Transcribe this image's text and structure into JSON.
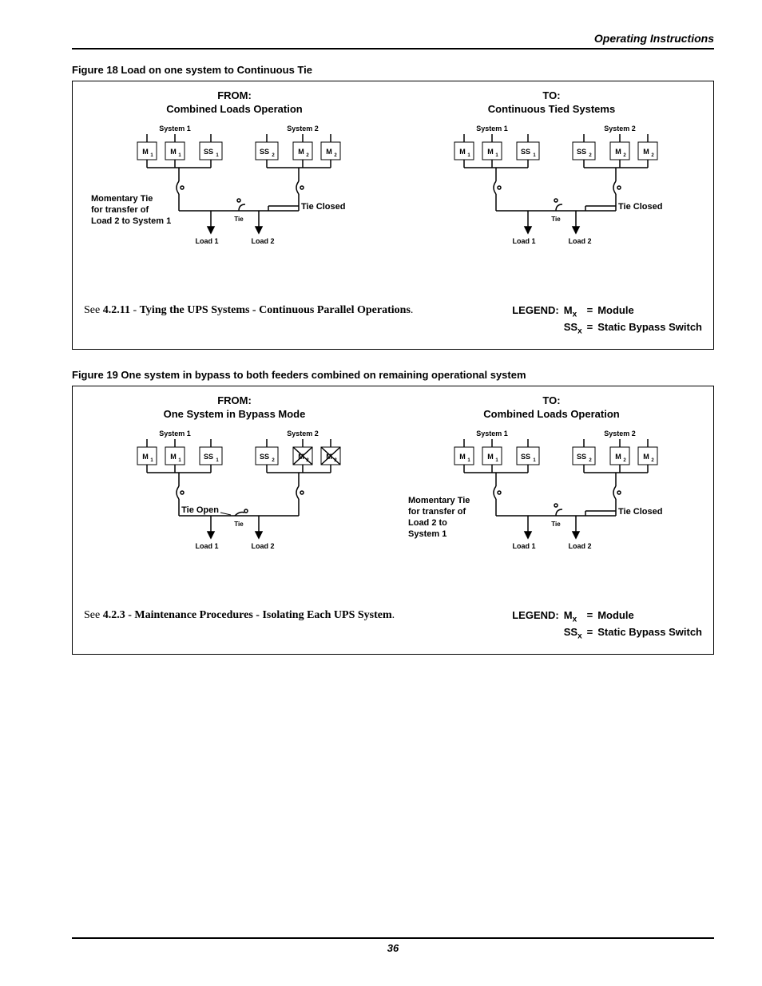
{
  "page": {
    "section_header": "Operating Instructions",
    "page_number": "36"
  },
  "figure18": {
    "title": "Figure 18  Load on one system to Continuous Tie",
    "from_l1": "FROM:",
    "from_l2": "Combined Loads Operation",
    "to_l1": "TO:",
    "to_l2": "Continuous Tied Systems",
    "see_prefix": "See ",
    "see_ref": "4.2.11",
    "see_dash": " - ",
    "see_bold": "Tying the UPS Systems - Continuous Parallel Operations",
    "see_period": ".",
    "left_note_l1": "Momentary Tie",
    "left_note_l2": "for transfer of",
    "left_note_l3": "Load 2 to System 1",
    "tie_closed": "Tie Closed",
    "sys1": "System 1",
    "sys2": "System 2",
    "load1": "Load 1",
    "load2": "Load 2",
    "tie": "Tie",
    "boxes": [
      "M",
      "M",
      "SS",
      "SS",
      "M",
      "M"
    ],
    "boxsubs": [
      "1",
      "1",
      "1",
      "2",
      "2",
      "2"
    ]
  },
  "figure19": {
    "title": "Figure 19  One system in bypass to both feeders combined on remaining operational system",
    "from_l1": "FROM:",
    "from_l2": "One System in Bypass Mode",
    "to_l1": "TO:",
    "to_l2": "Combined Loads Operation",
    "see_prefix": "See ",
    "see_ref": "4.2.3 - Maintenance Procedures - Isolating Each UPS System",
    "see_period": ".",
    "tie_open": "Tie Open",
    "tie_closed": "Tie Closed",
    "right_note_l1": "Momentary Tie",
    "right_note_l2": "for transfer of",
    "right_note_l3": "Load 2 to",
    "right_note_l4": "System 1",
    "sys1": "System 1",
    "sys2": "System 2",
    "load1": "Load 1",
    "load2": "Load 2",
    "tie": "Tie",
    "boxes": [
      "M",
      "M",
      "SS",
      "SS",
      "M",
      "M"
    ],
    "boxsubs": [
      "1",
      "1",
      "1",
      "2",
      "2",
      "2"
    ]
  },
  "legend": {
    "label": "LEGEND:",
    "m": "M",
    "msub": "x",
    "eq": "=",
    "mval": "Module",
    "ss": "SS",
    "sssub": "x",
    "ssval": "Static Bypass Switch"
  }
}
